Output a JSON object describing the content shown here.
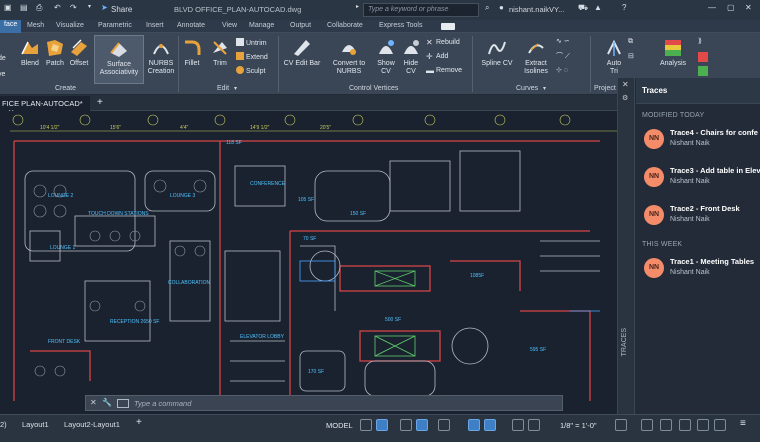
{
  "title_bar": {
    "share_label": "Share",
    "document_title": "BLVD OFFICE_PLAN-AUTOCAD.dwg",
    "search_placeholder": "Type a keyword or phrase",
    "user_name": "nishant.naikVY..."
  },
  "ribbon_tabs": [
    {
      "label": "face"
    },
    {
      "label": "Mesh"
    },
    {
      "label": "Visualize"
    },
    {
      "label": "Parametric"
    },
    {
      "label": "Insert"
    },
    {
      "label": "Annotate"
    },
    {
      "label": "View"
    },
    {
      "label": "Manage"
    },
    {
      "label": "Output"
    },
    {
      "label": "Collaborate"
    },
    {
      "label": "Express Tools"
    }
  ],
  "ribbon": {
    "create": {
      "partial_top": "de",
      "partial_bottom": "ve",
      "blend": "Blend",
      "patch": "Patch",
      "offset": "Offset",
      "surface_line1": "Surface",
      "surface_line2": "Associativity",
      "nurbs_line1": "NURBS",
      "nurbs_line2": "Creation",
      "panel": "Create"
    },
    "edit": {
      "fillet": "Fillet",
      "trim": "Trim",
      "untrim": "Untrim",
      "extend": "Extend",
      "sculpt": "Sculpt",
      "panel": "Edit"
    },
    "control_vertices": {
      "cv_edit_bar": "CV Edit Bar",
      "convert_line1": "Convert to",
      "convert_line2": "NURBS",
      "show_line1": "Show",
      "show_line2": "CV",
      "hide_line1": "Hide",
      "hide_line2": "CV",
      "rebuild": "Rebuild",
      "add": "Add",
      "remove": "Remove",
      "panel": "Control Vertices"
    },
    "curves": {
      "spline_cv": "Spline CV",
      "extract_line1": "Extract",
      "extract_line2": "Isolines",
      "panel": "Curves"
    },
    "project": {
      "auto_line1": "Auto",
      "auto_line2": "Tri",
      "panel": "Project"
    },
    "analysis": "Analysis"
  },
  "file_tab": "FICE PLAN-AUTOCAD*",
  "drawing": {
    "dimensions": [
      "10'4 1/2\"",
      "15'6\"",
      "4'4\"",
      "14'9 1/2\"",
      "20'5\""
    ],
    "rooms": [
      {
        "label": "LOUNGE 2"
      },
      {
        "label": "LOUNGE 3"
      },
      {
        "label": "CONFERENCE"
      },
      {
        "label": "TOUCH DOWN STATIONS"
      },
      {
        "label": "LOUNGE 1"
      },
      {
        "label": "COLLABORATION"
      },
      {
        "label": "RECEPTION 2650 SF"
      },
      {
        "label": "FRONT DESK"
      },
      {
        "label": "ELEVATOR LOBBY"
      },
      {
        "label": "118 SF"
      },
      {
        "label": "150 SF"
      },
      {
        "label": "70 SF"
      },
      {
        "label": "1085F"
      },
      {
        "label": "500 SF"
      },
      {
        "label": "595 SF"
      },
      {
        "label": "170 SF"
      },
      {
        "label": "105 SF"
      }
    ]
  },
  "traces_panel": {
    "side_label": "TRACES",
    "title": "Traces",
    "section_recent": "MODIFIED TODAY",
    "section_week": "THIS WEEK",
    "recent": [
      {
        "initials": "NN",
        "name": "Trace4 - Chairs for confe",
        "author": "Nishant Naik"
      },
      {
        "initials": "NN",
        "name": "Trace3 - Add table in Elev",
        "author": "Nishant Naik"
      },
      {
        "initials": "NN",
        "name": "Trace2 - Front Desk",
        "author": "Nishant Naik"
      }
    ],
    "week": [
      {
        "initials": "NN",
        "name": "Trace1 - Meeting Tables",
        "author": "Nishant Naik"
      }
    ]
  },
  "command_line": {
    "placeholder": "Type a command"
  },
  "status_bar": {
    "layout_partial": "2)",
    "layout1": "Layout1",
    "layout2": "Layout2-Layout1",
    "model": "MODEL",
    "scale": "1/8\" = 1'-0\""
  },
  "colors": {
    "accent": "#3f7fc6",
    "avatar": "#f48c6a",
    "background": "#1a2230",
    "ribbon": "#3a4656"
  }
}
